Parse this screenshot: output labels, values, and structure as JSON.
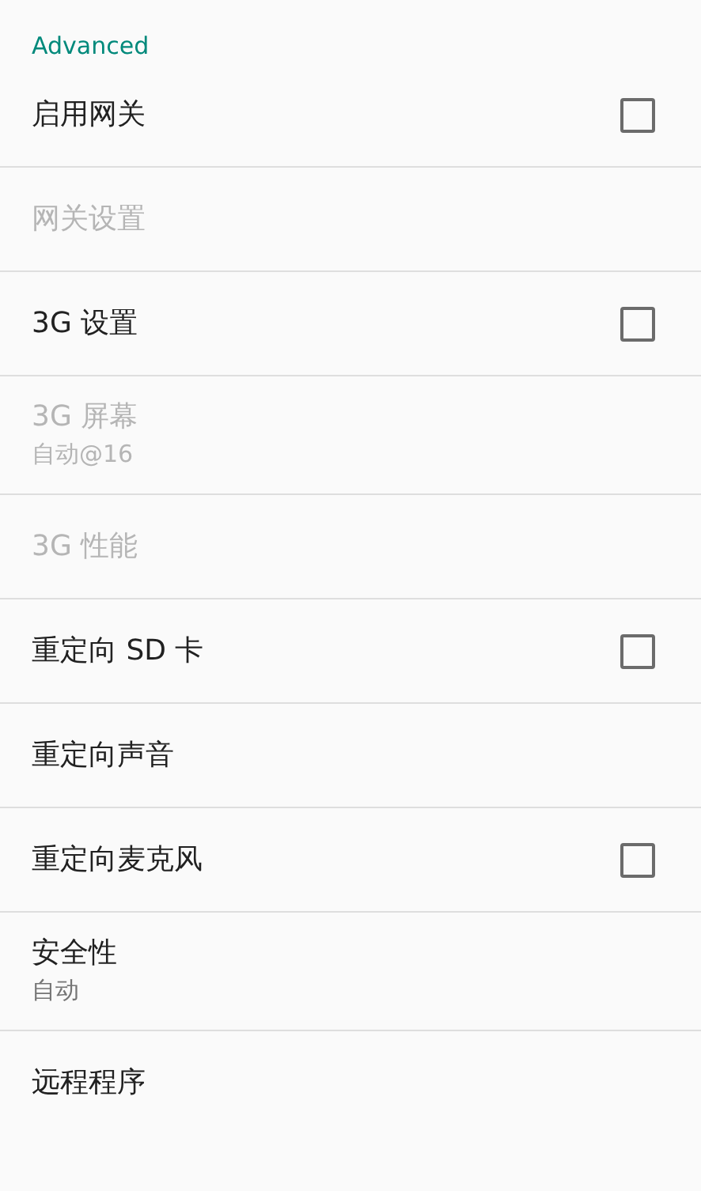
{
  "section_title": "Advanced",
  "preferences": [
    {
      "kind": "checkbox",
      "title": "启用网关",
      "disabled": false,
      "checked": false
    },
    {
      "kind": "plain",
      "title": "网关设置",
      "disabled": true
    },
    {
      "kind": "checkbox",
      "title": "3G 设置",
      "disabled": false,
      "checked": false
    },
    {
      "kind": "plain",
      "title": "3G 屏幕",
      "summary": "自动@16",
      "disabled": true
    },
    {
      "kind": "plain",
      "title": "3G 性能",
      "disabled": true
    },
    {
      "kind": "checkbox",
      "title": "重定向 SD 卡",
      "disabled": false,
      "checked": false
    },
    {
      "kind": "plain",
      "title": "重定向声音",
      "disabled": false
    },
    {
      "kind": "checkbox",
      "title": "重定向麦克风",
      "disabled": false,
      "checked": false
    },
    {
      "kind": "plain",
      "title": "安全性",
      "summary": "自动",
      "disabled": false
    },
    {
      "kind": "plain",
      "title": "远程程序",
      "disabled": false
    }
  ]
}
